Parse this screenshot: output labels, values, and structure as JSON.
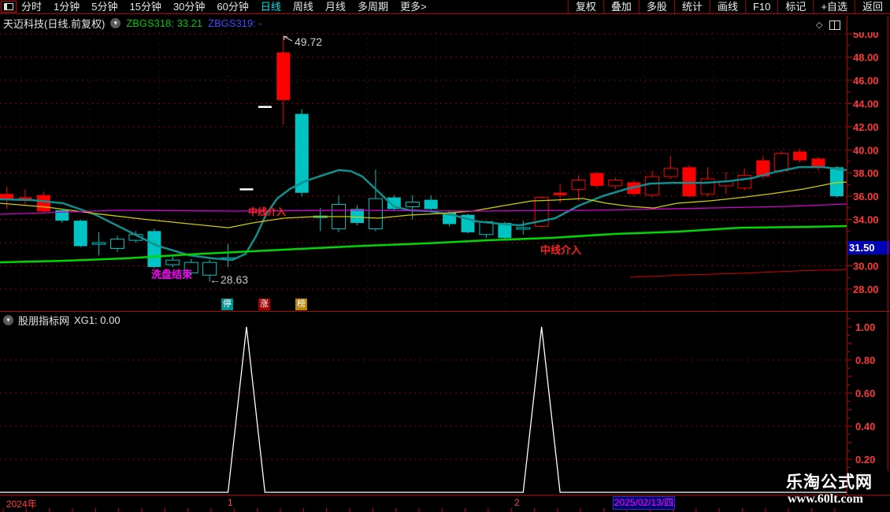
{
  "toolbar": {
    "left_items": [
      "分时",
      "1分钟",
      "5分钟",
      "15分钟",
      "30分钟",
      "60分钟",
      "日线",
      "周线",
      "月线",
      "多周期",
      "更多>"
    ],
    "active_item": "日线",
    "right_items": [
      "复权",
      "叠加",
      "多股",
      "统计",
      "画线",
      "F10",
      "标记",
      "+自选",
      "返回"
    ]
  },
  "title_bar": {
    "title": "天迈科技(日线.前复权)",
    "indicator1_label": "ZBGS318:",
    "indicator1_value": "33.21",
    "indicator2_label": "ZBGS319:",
    "indicator2_value": "-"
  },
  "badges": [
    {
      "label": "停",
      "bg": "#009393"
    },
    {
      "label": "涨",
      "bg": "#a40000"
    },
    {
      "label": "榜",
      "bg": "#b8860b"
    }
  ],
  "indicator_header": {
    "source": "股朋指标网",
    "series_label": "XG1:",
    "series_value": "0.00"
  },
  "watermark": {
    "line1": "乐淘公式网",
    "line2": "www.60lt.com"
  },
  "colors": {
    "candle_up": "#fd0000",
    "candle_down": "#00c3c3",
    "flat_candle": "#ffffff",
    "ma_teal": "#0f8f8f",
    "ma_yellow": "#cdcd00",
    "ma_magenta": "#d400d4",
    "trend_green": "#00d800",
    "aux_red": "#d40000",
    "grid": "#b40000",
    "grid_v": "#8b0000",
    "axis_text": "#ff3838",
    "spike_line": "#ffffff",
    "marker_bg": "#0000b4"
  },
  "chart_data": {
    "type": "candlestick",
    "main": {
      "price_ticks": [
        {
          "label": "50.00",
          "value": 50
        },
        {
          "label": "48.00",
          "value": 48
        },
        {
          "label": "46.00",
          "value": 46
        },
        {
          "label": "44.00",
          "value": 44
        },
        {
          "label": "42.00",
          "value": 42
        },
        {
          "label": "40.00",
          "value": 40
        },
        {
          "label": "38.00",
          "value": 38
        },
        {
          "label": "36.00",
          "value": 36
        },
        {
          "label": "34.00",
          "value": 34
        },
        {
          "label": "30.00",
          "value": 30
        },
        {
          "label": "28.00",
          "value": 28
        }
      ],
      "marker": {
        "label": "31.50",
        "value": 31.5
      },
      "candles": [
        [
          35.7,
          36.8,
          34.9,
          36.2,
          "r",
          "s"
        ],
        [
          35.6,
          36.6,
          35.3,
          35.9,
          "r",
          "s"
        ],
        [
          34.7,
          36.4,
          34.5,
          36.1,
          "r",
          "s"
        ],
        [
          34.8,
          34.9,
          33.7,
          33.9,
          "c",
          "s"
        ],
        [
          33.9,
          34.0,
          31.6,
          31.7,
          "c",
          "s"
        ],
        [
          32.0,
          32.9,
          30.9,
          31.9,
          "c",
          "h"
        ],
        [
          32.3,
          32.6,
          31.2,
          31.5,
          "c",
          "h"
        ],
        [
          32.7,
          33.0,
          32.0,
          32.2,
          "c",
          "h"
        ],
        [
          33.0,
          33.2,
          29.8,
          29.9,
          "c",
          "s"
        ],
        [
          30.5,
          30.8,
          29.9,
          30.1,
          "c",
          "h"
        ],
        [
          30.3,
          30.6,
          29.2,
          29.4,
          "c",
          "h"
        ],
        [
          30.3,
          30.5,
          28.63,
          29.2,
          "c",
          "h"
        ],
        [
          30.7,
          31.9,
          29.9,
          30.7,
          "c",
          "h"
        ],
        [
          36.6,
          36.6,
          36.6,
          36.6,
          "w",
          "d"
        ],
        [
          43.7,
          43.7,
          43.7,
          43.7,
          "w",
          "d"
        ],
        [
          44.3,
          49.72,
          42.2,
          48.4,
          "r",
          "s"
        ],
        [
          43.1,
          43.5,
          36.0,
          36.3,
          "c",
          "s"
        ],
        [
          34.3,
          35.0,
          33.0,
          34.2,
          "c",
          "h"
        ],
        [
          35.3,
          36.1,
          32.9,
          33.2,
          "c",
          "h"
        ],
        [
          34.9,
          35.2,
          33.5,
          33.7,
          "c",
          "s"
        ],
        [
          35.8,
          38.3,
          33.0,
          33.2,
          "c",
          "h"
        ],
        [
          35.9,
          36.1,
          34.7,
          34.9,
          "c",
          "s"
        ],
        [
          35.5,
          36.1,
          34.0,
          35.1,
          "c",
          "h"
        ],
        [
          35.7,
          36.1,
          34.7,
          34.9,
          "c",
          "s"
        ],
        [
          34.6,
          34.8,
          33.4,
          33.6,
          "c",
          "s"
        ],
        [
          34.4,
          34.5,
          32.8,
          32.9,
          "c",
          "s"
        ],
        [
          33.8,
          33.9,
          32.4,
          32.7,
          "c",
          "h"
        ],
        [
          33.7,
          33.8,
          32.2,
          32.4,
          "c",
          "s"
        ],
        [
          33.3,
          33.9,
          32.7,
          33.2,
          "c",
          "h"
        ],
        [
          33.4,
          36.0,
          33.3,
          35.9,
          "r",
          "h"
        ],
        [
          36.1,
          37.1,
          35.4,
          36.3,
          "r",
          "s"
        ],
        [
          36.6,
          37.8,
          35.6,
          37.4,
          "r",
          "h"
        ],
        [
          36.9,
          38.1,
          36.7,
          38.0,
          "r",
          "s"
        ],
        [
          36.9,
          37.6,
          36.6,
          37.4,
          "r",
          "h"
        ],
        [
          36.2,
          37.4,
          36.0,
          37.2,
          "r",
          "s"
        ],
        [
          36.1,
          38.2,
          35.9,
          37.7,
          "r",
          "h"
        ],
        [
          37.7,
          39.5,
          37.5,
          38.4,
          "r",
          "h"
        ],
        [
          36.0,
          38.7,
          35.9,
          38.5,
          "r",
          "s"
        ],
        [
          36.2,
          38.5,
          36.0,
          37.5,
          "r",
          "h"
        ],
        [
          36.9,
          38.1,
          36.2,
          37.3,
          "r",
          "h"
        ],
        [
          36.7,
          38.4,
          36.5,
          37.8,
          "r",
          "h"
        ],
        [
          37.7,
          39.5,
          37.5,
          39.1,
          "r",
          "s"
        ],
        [
          38.2,
          39.9,
          38.0,
          39.7,
          "r",
          "h"
        ],
        [
          39.1,
          40.1,
          38.9,
          39.85,
          "r",
          "s"
        ],
        [
          38.45,
          39.4,
          38.2,
          39.25,
          "r",
          "s"
        ],
        [
          38.5,
          38.6,
          35.9,
          36.0,
          "c",
          "s"
        ]
      ],
      "overlays": [
        {
          "name": "ma-teal",
          "color_key": "ma_teal",
          "width": 2.5,
          "points": [
            [
              0,
              35.74
            ],
            [
              40,
              35.67
            ],
            [
              80,
              35.4
            ],
            [
              120,
              34.45
            ],
            [
              160,
              33.09
            ],
            [
              200,
              31.73
            ],
            [
              240,
              30.92
            ],
            [
              270,
              30.65
            ],
            [
              295,
              30.51
            ],
            [
              312,
              31.05
            ],
            [
              325,
              32.55
            ],
            [
              338,
              34.45
            ],
            [
              352,
              35.81
            ],
            [
              368,
              36.62
            ],
            [
              385,
              37.23
            ],
            [
              405,
              37.71
            ],
            [
              430,
              38.25
            ],
            [
              445,
              38.18
            ],
            [
              460,
              37.71
            ],
            [
              480,
              36.42
            ],
            [
              500,
              35.13
            ],
            [
              520,
              34.79
            ],
            [
              545,
              34.72
            ],
            [
              575,
              34.38
            ],
            [
              605,
              33.84
            ],
            [
              635,
              33.63
            ],
            [
              660,
              33.5
            ],
            [
              685,
              33.84
            ],
            [
              705,
              34.11
            ],
            [
              735,
              35.2
            ],
            [
              765,
              36.01
            ],
            [
              795,
              36.62
            ],
            [
              825,
              37.09
            ],
            [
              855,
              37.16
            ],
            [
              895,
              37.16
            ],
            [
              925,
              37.3
            ],
            [
              955,
              37.57
            ],
            [
              985,
              38.11
            ],
            [
              1015,
              38.52
            ],
            [
              1045,
              38.52
            ],
            [
              1075,
              38.25
            ]
          ]
        },
        {
          "name": "ma-yellow",
          "color_key": "ma_yellow",
          "width": 1.3,
          "points": [
            [
              0,
              35.4
            ],
            [
              60,
              35.06
            ],
            [
              120,
              34.52
            ],
            [
              180,
              34.04
            ],
            [
              240,
              33.63
            ],
            [
              290,
              33.29
            ],
            [
              320,
              33.7
            ],
            [
              360,
              34.11
            ],
            [
              400,
              34.25
            ],
            [
              440,
              34.25
            ],
            [
              480,
              34.11
            ],
            [
              520,
              34.38
            ],
            [
              560,
              34.52
            ],
            [
              600,
              34.72
            ],
            [
              640,
              35.2
            ],
            [
              675,
              35.6
            ],
            [
              705,
              35.67
            ],
            [
              740,
              35.81
            ],
            [
              770,
              35.4
            ],
            [
              800,
              35.13
            ],
            [
              830,
              34.99
            ],
            [
              860,
              35.4
            ],
            [
              900,
              35.6
            ],
            [
              940,
              35.88
            ],
            [
              980,
              36.22
            ],
            [
              1020,
              36.62
            ],
            [
              1060,
              37.16
            ],
            [
              1075,
              37.23
            ]
          ]
        },
        {
          "name": "ma-magenta",
          "color_key": "ma_magenta",
          "width": 1.3,
          "points": [
            [
              0,
              34.45
            ],
            [
              150,
              34.79
            ],
            [
              300,
              34.72
            ],
            [
              450,
              34.79
            ],
            [
              600,
              34.72
            ],
            [
              750,
              34.79
            ],
            [
              900,
              34.99
            ],
            [
              1000,
              35.13
            ],
            [
              1075,
              35.33
            ]
          ]
        },
        {
          "name": "trend-green",
          "color_key": "trend_green",
          "width": 2.5,
          "points": [
            [
              0,
              30.31
            ],
            [
              80,
              30.44
            ],
            [
              160,
              30.65
            ],
            [
              240,
              30.99
            ],
            [
              300,
              31.19
            ],
            [
              380,
              31.46
            ],
            [
              460,
              31.73
            ],
            [
              540,
              31.94
            ],
            [
              620,
              32.21
            ],
            [
              700,
              32.41
            ],
            [
              780,
              32.75
            ],
            [
              860,
              32.95
            ],
            [
              940,
              33.29
            ],
            [
              1020,
              33.36
            ],
            [
              1075,
              33.43
            ]
          ]
        },
        {
          "name": "aux-red",
          "color_key": "aux_red",
          "width": 1,
          "points": [
            [
              800,
              29.02
            ],
            [
              870,
              29.22
            ],
            [
              940,
              29.36
            ],
            [
              1010,
              29.56
            ],
            [
              1075,
              29.7
            ]
          ]
        }
      ],
      "annotations": [
        {
          "text": "49.72",
          "x": 374,
          "y": 58,
          "color": "#d2d2d2",
          "size": 14,
          "arrow": [
            [
              360,
              46
            ],
            [
              371,
              52
            ]
          ]
        },
        {
          "text": "←28.63",
          "x": 266,
          "y": 360,
          "color": "#c8c8c8",
          "size": 14
        },
        {
          "text": "中线介入",
          "x": 315,
          "y": 273,
          "color": "#ff2222",
          "size": 12,
          "bold": true
        },
        {
          "text": "中线介入",
          "x": 686,
          "y": 322,
          "color": "#ff2222",
          "size": 13,
          "bold": true
        },
        {
          "text": "洗盘结束",
          "x": 192,
          "y": 353,
          "color": "#ff00ff",
          "size": 13,
          "bold": true
        }
      ]
    },
    "indicator": {
      "name": "XG1",
      "values": [
        0,
        0,
        0,
        0,
        0,
        0,
        0,
        0,
        0,
        0,
        0,
        0,
        0,
        1,
        0,
        0,
        0,
        0,
        0,
        0,
        0,
        0,
        0,
        0,
        0,
        0,
        0,
        0,
        0,
        1,
        0,
        0,
        0,
        0,
        0,
        0,
        0,
        0,
        0,
        0,
        0,
        0,
        0,
        0,
        0,
        0
      ],
      "yticks": [
        {
          "label": "1.00",
          "value": 1.0
        },
        {
          "label": "0.80",
          "value": 0.8
        },
        {
          "label": "0.60",
          "value": 0.6
        },
        {
          "label": "0.40",
          "value": 0.4
        },
        {
          "label": "0.20",
          "value": 0.2
        }
      ]
    },
    "x_axis": {
      "year_label": "2024年",
      "month_labels": [
        {
          "label": "1",
          "x": 289
        },
        {
          "label": "2",
          "x": 653
        }
      ],
      "last_date": "2025/02/13/四"
    }
  }
}
